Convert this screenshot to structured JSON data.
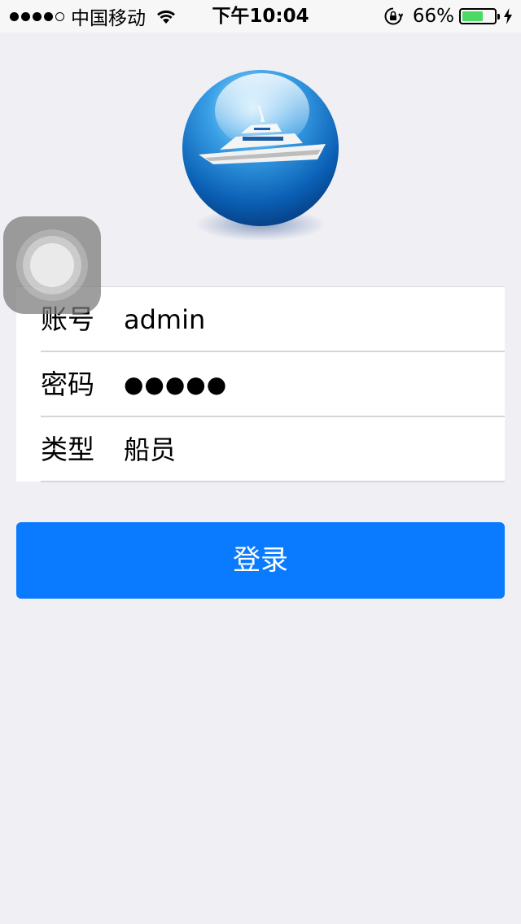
{
  "status_bar": {
    "carrier": "中国移动",
    "time": "下午10:04",
    "battery_percent": "66%",
    "battery_level": 0.66,
    "signal_bars_filled": 4,
    "signal_bars_total": 5,
    "icons": [
      "signal-dots-icon",
      "wifi-icon",
      "orientation-lock-icon",
      "battery-icon",
      "charging-bolt-icon"
    ]
  },
  "logo": {
    "icon": "ship-globe-logo"
  },
  "assistive_touch": {
    "icon": "assistive-touch-icon"
  },
  "login_form": {
    "account": {
      "label": "账号",
      "value": "admin"
    },
    "password": {
      "label": "密码",
      "masked_value": "●●●●●"
    },
    "type": {
      "label": "类型",
      "value": "船员"
    }
  },
  "login_button": {
    "label": "登录"
  },
  "colors": {
    "background": "#efeff4",
    "primary_button": "#0a7bff",
    "battery_fill": "#4cd964"
  }
}
